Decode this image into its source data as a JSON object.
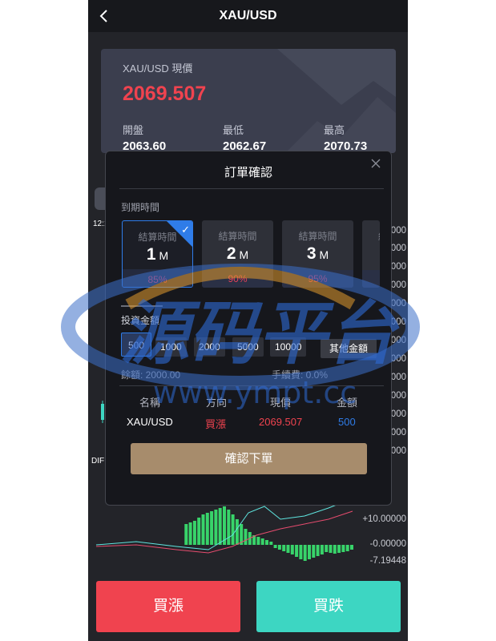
{
  "header": {
    "title": "XAU/USD"
  },
  "quote": {
    "label": "XAU/USD 現價",
    "price": "2069.507",
    "stats": [
      {
        "label": "開盤",
        "value": "2063.60"
      },
      {
        "label": "最低",
        "value": "2062.67"
      },
      {
        "label": "最高",
        "value": "2070.73"
      }
    ]
  },
  "chart": {
    "time_label": "12:1",
    "y_ticks_top": [
      "0000",
      "0000",
      "0000",
      "0000",
      "0000",
      "0000",
      "0000",
      "0000",
      "0000",
      "0000",
      "0000",
      "0000",
      "0000"
    ],
    "dif_label": "DIF",
    "macd_ticks": [
      "+10.00000",
      "-0.00000",
      "-7.19448"
    ],
    "colors": {
      "macd_bar": "#38d46a",
      "dif_line": "#5fe6e0",
      "dea_line": "#e64c6e"
    }
  },
  "modal": {
    "title": "訂單確認",
    "expiry_label": "到期時間",
    "durations": [
      {
        "label": "結算時間",
        "value": "1",
        "unit": "M",
        "rate": "85%",
        "selected": true
      },
      {
        "label": "結算時間",
        "value": "2",
        "unit": "M",
        "rate": "90%",
        "selected": false
      },
      {
        "label": "結算時間",
        "value": "3",
        "unit": "M",
        "rate": "95%",
        "selected": false
      },
      {
        "label": "結",
        "value": "",
        "unit": "",
        "rate": "",
        "selected": false
      }
    ],
    "amount_label": "投資金額",
    "amounts": [
      "500",
      "1000",
      "2000",
      "5000",
      "10000"
    ],
    "other_amount": "其他金額",
    "balance": "餘額: 2000.00",
    "fee": "手續費: 0.0%",
    "table": {
      "headers": [
        "名稱",
        "方向",
        "現價",
        "金額"
      ],
      "row": {
        "name": "XAU/USD",
        "direction": "買漲",
        "price": "2069.507",
        "amount": "500"
      }
    },
    "confirm_label": "確認下單"
  },
  "actions": {
    "buy_up": "買漲",
    "buy_down": "買跌"
  },
  "watermark": {
    "text_cn": "源码平台",
    "text_url": "www.ympt.cc"
  },
  "icons": {
    "back": "chevron-left-icon",
    "close": "close-icon",
    "check": "check-icon"
  },
  "colors": {
    "up": "#f0434f",
    "down": "#3dd6c2",
    "accent": "#2f7ce8",
    "confirm": "#a78c6c"
  }
}
